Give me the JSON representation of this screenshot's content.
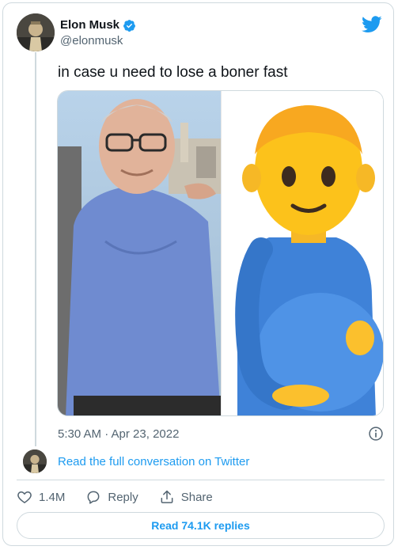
{
  "tweet": {
    "author_name": "Elon Musk",
    "author_handle": "@elonmusk",
    "text": "in case u need to lose a boner fast",
    "timestamp": "5:30 AM · Apr 23, 2022",
    "conversation_link": "Read the full conversation on Twitter",
    "actions": {
      "like_count": "1.4M",
      "reply_label": "Reply",
      "share_label": "Share"
    },
    "read_replies_label": "Read 74.1K replies"
  },
  "icons": {
    "verified": "verified-badge-icon",
    "brand": "twitter-bird-icon",
    "info": "info-icon",
    "like": "heart-icon",
    "reply": "speech-bubble-icon",
    "share": "share-upload-icon"
  },
  "colors": {
    "accent": "#1d9bf0",
    "text": "#0f1419",
    "muted": "#536471",
    "border": "#cfd9de"
  }
}
